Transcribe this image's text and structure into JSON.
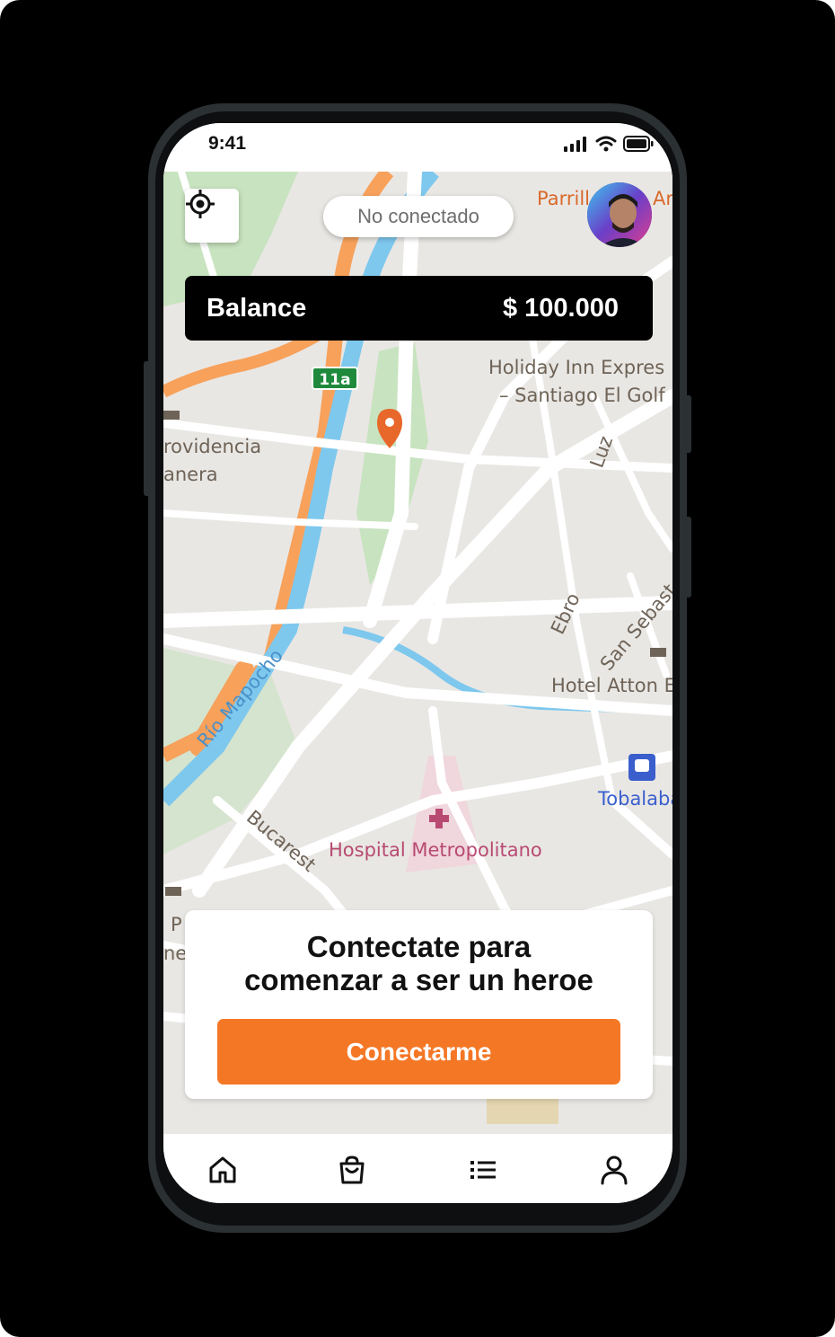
{
  "status_bar": {
    "time": "9:41"
  },
  "top": {
    "status_pill": "No conectado"
  },
  "balance": {
    "label": "Balance",
    "amount": "$ 100.000"
  },
  "map": {
    "labels": {
      "parri": "Parrill",
      "ar": "Ar",
      "holiday1": "Holiday Inn Expres",
      "holiday2": "– Santiago El Golf",
      "providencia": "rovidencia",
      "anera": "anera",
      "luz": "Luz",
      "ebro": "Ebro",
      "sansebas": "San Sebast",
      "hotel": "Hotel Atton E",
      "tobalaba": "Tobalaba",
      "rio": "Río Mapocho",
      "bucarest": "Bucarest",
      "hospital": "Hospital Metropolitano",
      "p": "P",
      "ne": "ne",
      "route": "11a"
    }
  },
  "card": {
    "title_line1": "Contectate para",
    "title_line2": "comenzar a ser un heroe",
    "button_label": "Conectarme"
  },
  "tabs": [
    "home-icon",
    "shopping-bag-icon",
    "list-icon",
    "user-icon"
  ],
  "colors": {
    "accent": "#f47726",
    "pin": "#e8672a",
    "river": "#7ec8ee",
    "highway": "#f7a15b"
  }
}
